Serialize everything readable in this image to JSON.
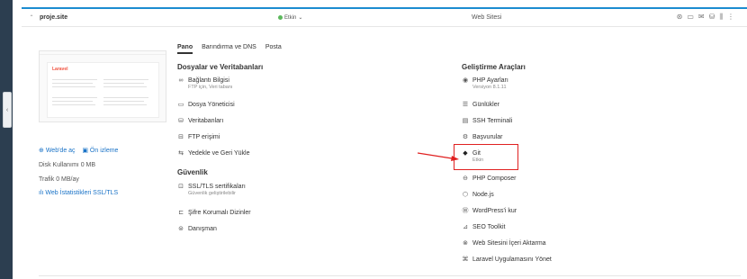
{
  "rail": {
    "handle_glyph": "‹"
  },
  "header": {
    "domain": "proje.site",
    "status": "Etkin",
    "status_caret": "⌄",
    "site_type": "Web Sitesi"
  },
  "thumbnail": {
    "logo_text": "Laravel"
  },
  "left": {
    "web_open": "Web'de aç",
    "preview": "Ön izleme",
    "disk_label": "Disk Kullanımı",
    "disk_value": "0 MB",
    "traffic_label": "Trafik",
    "traffic_value": "0 MB/ay",
    "stats_link": "Web İstatistikleri SSL/TLS"
  },
  "tabs": [
    {
      "label": "Pano",
      "active": true
    },
    {
      "label": "Barındırma ve DNS",
      "active": false
    },
    {
      "label": "Posta",
      "active": false
    }
  ],
  "sections": {
    "files": {
      "title": "Dosyalar ve Veritabanları",
      "items": [
        {
          "label": "Bağlantı Bilgisi",
          "sub": "FTP için, Veri tabanı",
          "icon": "link-icon"
        },
        {
          "label": "Dosya Yöneticisi",
          "sub": "",
          "icon": "folder-icon"
        },
        {
          "label": "Veritabanları",
          "sub": "",
          "icon": "database-icon"
        },
        {
          "label": "FTP erişimi",
          "sub": "",
          "icon": "ftp-icon"
        },
        {
          "label": "Yedekle ve Geri Yükle",
          "sub": "",
          "icon": "backup-icon"
        }
      ]
    },
    "security": {
      "title": "Güvenlik",
      "items": [
        {
          "label": "SSL/TLS sertifikaları",
          "sub": "Güvenlik geliştirilebilir",
          "icon": "lock-icon"
        },
        {
          "label": "Şifre Korumalı Dizinler",
          "sub": "",
          "icon": "protected-folder-icon"
        },
        {
          "label": "Danışman",
          "sub": "",
          "icon": "advisor-icon"
        }
      ]
    },
    "devtools": {
      "title": "Geliştirme Araçları",
      "items": [
        {
          "label": "PHP Ayarları",
          "sub": "Versiyon 8.1.11",
          "icon": "php-icon"
        },
        {
          "label": "Günlükler",
          "sub": "",
          "icon": "logs-icon"
        },
        {
          "label": "SSH Terminali",
          "sub": "",
          "icon": "terminal-icon"
        },
        {
          "label": "Başvurular",
          "sub": "",
          "icon": "applications-icon"
        },
        {
          "label": "Git",
          "sub": "Etkin",
          "icon": "git-icon"
        },
        {
          "label": "PHP Composer",
          "sub": "",
          "icon": "composer-icon"
        },
        {
          "label": "Node.js",
          "sub": "",
          "icon": "nodejs-icon"
        },
        {
          "label": "WordPress'i kur",
          "sub": "",
          "icon": "wordpress-icon"
        },
        {
          "label": "SEO Toolkit",
          "sub": "",
          "icon": "seo-icon"
        },
        {
          "label": "Web Sitesini İçeri Aktarma",
          "sub": "",
          "icon": "import-icon"
        },
        {
          "label": "Laravel Uygulamasını Yönet",
          "sub": "",
          "icon": "laravel-icon"
        }
      ]
    }
  },
  "colors": {
    "accent": "#1c8cd0",
    "link": "#1a73c7",
    "highlight": "#e02020",
    "status_ok": "#5cb85c"
  }
}
